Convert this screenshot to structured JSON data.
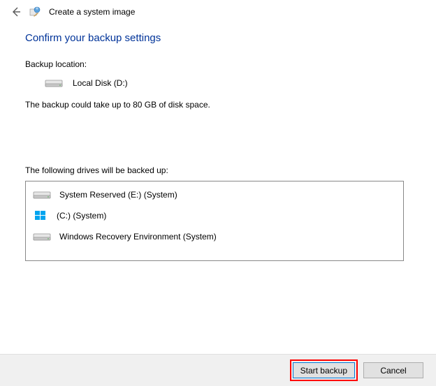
{
  "header": {
    "title": "Create a system image"
  },
  "main": {
    "heading": "Confirm your backup settings",
    "location_label": "Backup location:",
    "location_value": "Local Disk (D:)",
    "size_text": "The backup could take up to 80 GB of disk space.",
    "drives_label": "The following drives will be backed up:",
    "drives": [
      {
        "name": "System Reserved (E:) (System)",
        "icon": "drive"
      },
      {
        "name": "(C:) (System)",
        "icon": "windows"
      },
      {
        "name": "Windows Recovery Environment (System)",
        "icon": "drive"
      }
    ]
  },
  "footer": {
    "start_label": "Start backup",
    "cancel_label": "Cancel"
  }
}
